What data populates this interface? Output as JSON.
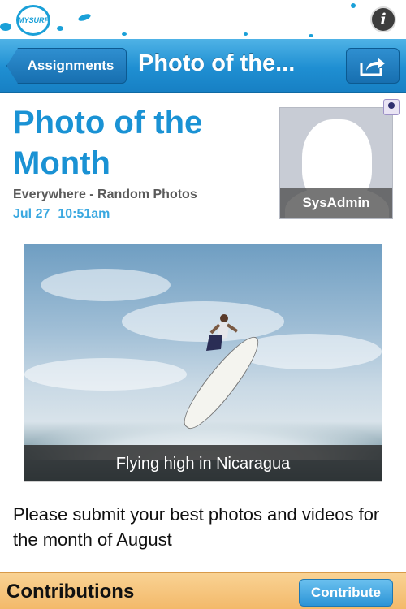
{
  "header": {
    "logo_text": "MYSURF",
    "info_icon": "info-icon"
  },
  "navbar": {
    "back_label": "Assignments",
    "title": "Photo of the...",
    "share_icon": "share-icon"
  },
  "assignment": {
    "title": "Photo of the Month",
    "location": "Everywhere - Random Photos",
    "date": "Jul 27",
    "time": "10:51am",
    "author": "SysAdmin",
    "photo_caption": "Flying high in Nicaragua",
    "description": "Please submit your best photos and videos for the month of August"
  },
  "contributions": {
    "title": "Contributions",
    "button_label": "Contribute"
  },
  "colors": {
    "accent": "#1a92d4",
    "date": "#3aa8e0",
    "contrib_bar": "#f3b96a"
  }
}
